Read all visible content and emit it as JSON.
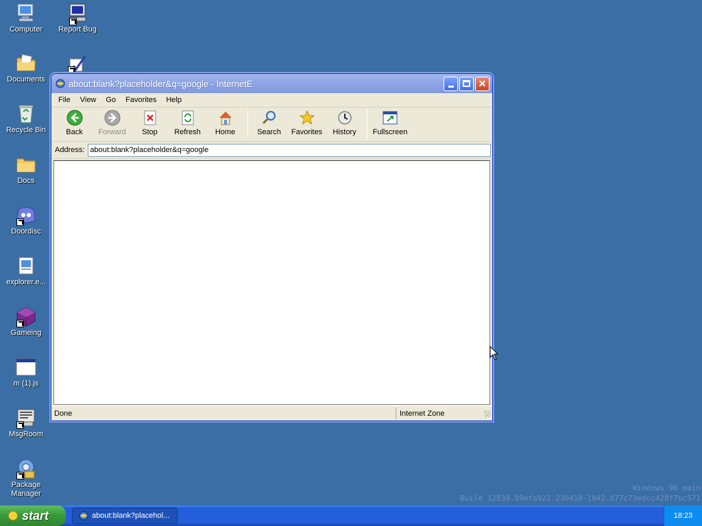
{
  "desktop": {
    "icons": [
      {
        "label": "Computer"
      },
      {
        "label": "Report Bug"
      },
      {
        "label": "Documents"
      },
      {
        "label": ""
      },
      {
        "label": "Recycle Bin"
      },
      {
        "label": "Docs"
      },
      {
        "label": "Doordisc"
      },
      {
        "label": "explorer.e..."
      },
      {
        "label": "Gameing"
      },
      {
        "label": "m (1).js"
      },
      {
        "label": "MsgRoom"
      },
      {
        "label": "Package Manager"
      }
    ],
    "background_color": "#3a6ea5"
  },
  "window": {
    "title": "about:blank?placeholder&q=google - InternetE",
    "menu": [
      "File",
      "View",
      "Go",
      "Favorites",
      "Help"
    ],
    "toolbar": [
      {
        "label": "Back",
        "icon": "back-arrow-icon",
        "enabled": true
      },
      {
        "label": "Forward",
        "icon": "forward-arrow-icon",
        "enabled": false
      },
      {
        "label": "Stop",
        "icon": "stop-icon",
        "enabled": true
      },
      {
        "label": "Refresh",
        "icon": "refresh-icon",
        "enabled": true
      },
      {
        "label": "Home",
        "icon": "home-icon",
        "enabled": true
      },
      {
        "label": "Search",
        "icon": "search-icon",
        "enabled": true
      },
      {
        "label": "Favorites",
        "icon": "star-icon",
        "enabled": true
      },
      {
        "label": "History",
        "icon": "history-icon",
        "enabled": true
      },
      {
        "label": "Fullscreen",
        "icon": "fullscreen-icon",
        "enabled": true
      }
    ],
    "address_label": "Address:",
    "address_value": "about:blank?placeholder&q=google",
    "status": {
      "main": "Done",
      "zone": "Internet Zone"
    }
  },
  "watermark": {
    "line1": "Windows 96 main",
    "line2": "Build 12839.89efa922.230410-1942.d77c73edcc428f7bc571"
  },
  "taskbar": {
    "start_label": "start",
    "task_label": "about:blank?placehol...",
    "clock": "18:23"
  }
}
